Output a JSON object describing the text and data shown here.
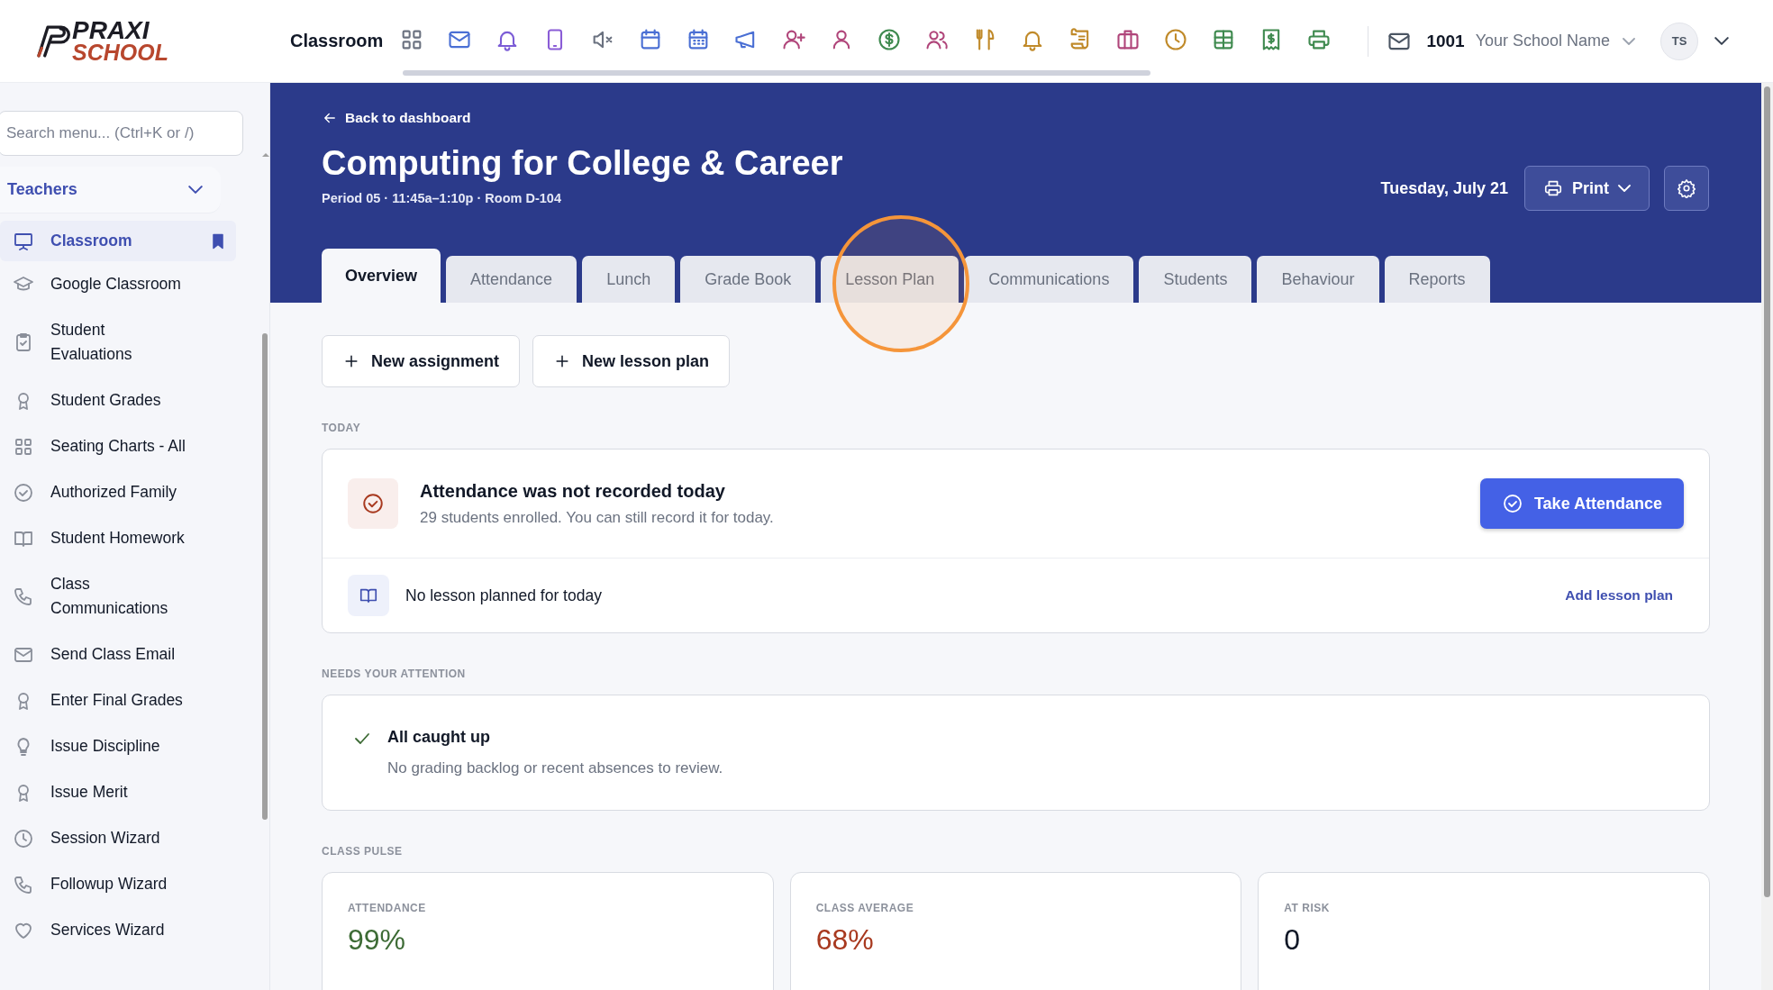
{
  "topbar": {
    "logo": {
      "line_1": "PRAXI",
      "line_2": "SCHOOL"
    },
    "module": "Classroom",
    "school_code": "1001",
    "school_name": "Your School Name",
    "avatar": "TS"
  },
  "sidebar": {
    "search": {
      "placeholder": "Search menu... (Ctrl+K or /)"
    },
    "section": {
      "label": "Teachers",
      "expanded": true
    },
    "items": [
      {
        "label": "Classroom",
        "selected": true,
        "bookmarked": true
      },
      {
        "label": "Google Classroom",
        "selected": false,
        "bookmarked": false
      },
      {
        "label": "Student Evaluations",
        "selected": false,
        "bookmarked": false
      },
      {
        "label": "Student Grades",
        "selected": false,
        "bookmarked": false
      },
      {
        "label": "Seating Charts - All",
        "selected": false,
        "bookmarked": false
      },
      {
        "label": "Authorized Family",
        "selected": false,
        "bookmarked": false
      },
      {
        "label": "Student Homework",
        "selected": false,
        "bookmarked": false
      },
      {
        "label": "Class Communications",
        "selected": false,
        "bookmarked": false
      },
      {
        "label": "Send Class Email",
        "selected": false,
        "bookmarked": false
      },
      {
        "label": "Enter Final Grades",
        "selected": false,
        "bookmarked": false
      },
      {
        "label": "Issue Discipline",
        "selected": false,
        "bookmarked": false
      },
      {
        "label": "Issue Merit",
        "selected": false,
        "bookmarked": false
      },
      {
        "label": "Session Wizard",
        "selected": false,
        "bookmarked": false
      },
      {
        "label": "Followup Wizard",
        "selected": false,
        "bookmarked": false
      },
      {
        "label": "Services Wizard",
        "selected": false,
        "bookmarked": false
      }
    ]
  },
  "header": {
    "back_link": "Back to dashboard",
    "title": "Computing for College & Career",
    "subtitle": "Period 05 · 11:45a–1:10p · Room D-104",
    "date": "Tuesday, July 21",
    "print_button": "Print",
    "tabs": [
      {
        "label": "Overview",
        "selected": true
      },
      {
        "label": "Attendance",
        "selected": false
      },
      {
        "label": "Lunch",
        "selected": false
      },
      {
        "label": "Grade Book",
        "selected": false
      },
      {
        "label": "Lesson Plan",
        "selected": false
      },
      {
        "label": "Communications",
        "selected": false
      },
      {
        "label": "Students",
        "selected": false
      },
      {
        "label": "Behaviour",
        "selected": false
      },
      {
        "label": "Reports",
        "selected": false
      }
    ]
  },
  "actions": [
    "New assignment",
    "New lesson plan"
  ],
  "today": {
    "heading": "TODAY",
    "attendance": {
      "title": "Attendance was not recorded today",
      "detail": "29 students enrolled. You can still record it for today.",
      "button": "Take Attendance"
    },
    "lesson": {
      "text": "No lesson planned for today",
      "link": "Add lesson plan"
    }
  },
  "attention": {
    "heading": "NEEDS YOUR ATTENTION",
    "title": "All caught up",
    "detail": "No grading backlog or recent absences to review."
  },
  "pulse": {
    "heading": "CLASS PULSE",
    "stats": [
      {
        "label": "ATTENDANCE",
        "value": "99%",
        "color": "#3d6b35"
      },
      {
        "label": "CLASS AVERAGE",
        "value": "68%",
        "color": "#a8391f"
      },
      {
        "label": "AT RISK",
        "value": "0",
        "color": "#111827"
      }
    ]
  }
}
